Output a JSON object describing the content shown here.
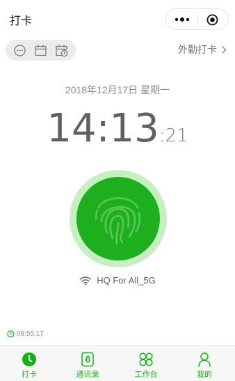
{
  "header": {
    "title": "打卡"
  },
  "toolbar": {
    "icons": [
      "chat-bubble-icon",
      "calendar-icon",
      "calendar-clock-icon"
    ],
    "field_checkin": "外勤打卡"
  },
  "main": {
    "date": "2018年12月17日 星期一",
    "time_hm": "14:13",
    "time_sec": ":21",
    "wifi_name": "HQ For All_5G",
    "last_punch_time": "08:55:17"
  },
  "tabs": [
    {
      "label": "打卡",
      "icon": "clock-icon",
      "active": true
    },
    {
      "label": "通讯录",
      "icon": "contacts-book-icon",
      "active": false
    },
    {
      "label": "工作台",
      "icon": "workbench-grid-icon",
      "active": false
    },
    {
      "label": "我的",
      "icon": "person-icon",
      "active": false
    }
  ],
  "colors": {
    "accent": "#1aad19",
    "punch_button": "#1eaf1e",
    "punch_ring": "#c7efc2",
    "tool_pill": "#ececec",
    "tabbar_bg": "#f7f7f7"
  }
}
